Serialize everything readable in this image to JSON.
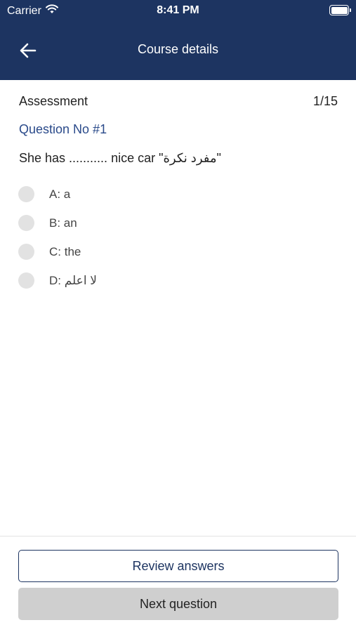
{
  "status_bar": {
    "carrier": "Carrier",
    "time": "8:41 PM"
  },
  "nav": {
    "title": "Course details",
    "back_icon": "arrow-left-icon"
  },
  "assessment": {
    "label": "Assessment",
    "progress": "1/15"
  },
  "question": {
    "number_label": "Question No #1",
    "text": "She has ........... nice car \"مفرد نكرة\""
  },
  "options": [
    {
      "label": "A: a"
    },
    {
      "label": "B: an"
    },
    {
      "label": "C: the"
    },
    {
      "label": "D: لا اعلم"
    }
  ],
  "buttons": {
    "review_label": "Review answers",
    "next_label": "Next question"
  },
  "colors": {
    "header_bg": "#1d3461",
    "accent": "#2a4a8a",
    "disabled_button": "#cfcfcf"
  }
}
